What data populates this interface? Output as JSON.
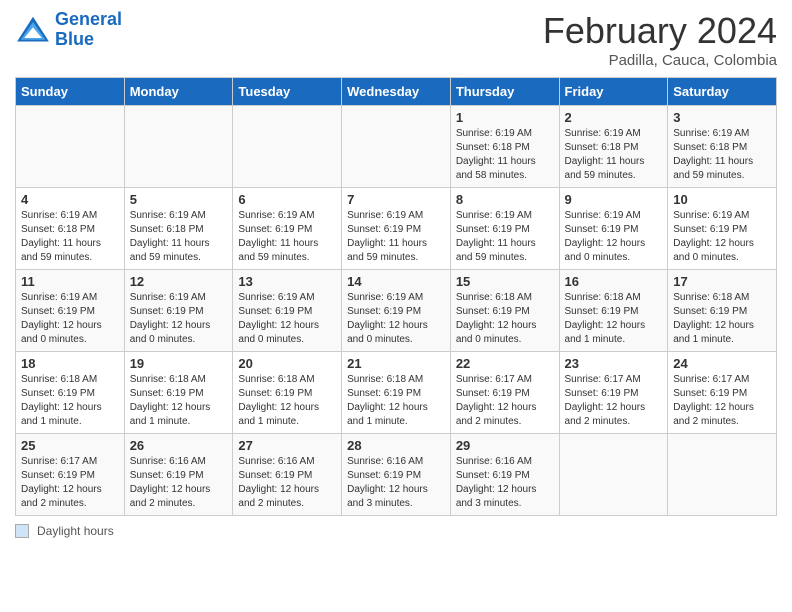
{
  "logo": {
    "line1": "General",
    "line2": "Blue"
  },
  "header": {
    "month": "February 2024",
    "location": "Padilla, Cauca, Colombia"
  },
  "weekdays": [
    "Sunday",
    "Monday",
    "Tuesday",
    "Wednesday",
    "Thursday",
    "Friday",
    "Saturday"
  ],
  "legend_label": "Daylight hours",
  "weeks": [
    [
      {
        "day": "",
        "sunrise": "",
        "sunset": "",
        "daylight": ""
      },
      {
        "day": "",
        "sunrise": "",
        "sunset": "",
        "daylight": ""
      },
      {
        "day": "",
        "sunrise": "",
        "sunset": "",
        "daylight": ""
      },
      {
        "day": "",
        "sunrise": "",
        "sunset": "",
        "daylight": ""
      },
      {
        "day": "1",
        "sunrise": "Sunrise: 6:19 AM",
        "sunset": "Sunset: 6:18 PM",
        "daylight": "Daylight: 11 hours and 58 minutes."
      },
      {
        "day": "2",
        "sunrise": "Sunrise: 6:19 AM",
        "sunset": "Sunset: 6:18 PM",
        "daylight": "Daylight: 11 hours and 59 minutes."
      },
      {
        "day": "3",
        "sunrise": "Sunrise: 6:19 AM",
        "sunset": "Sunset: 6:18 PM",
        "daylight": "Daylight: 11 hours and 59 minutes."
      }
    ],
    [
      {
        "day": "4",
        "sunrise": "Sunrise: 6:19 AM",
        "sunset": "Sunset: 6:18 PM",
        "daylight": "Daylight: 11 hours and 59 minutes."
      },
      {
        "day": "5",
        "sunrise": "Sunrise: 6:19 AM",
        "sunset": "Sunset: 6:18 PM",
        "daylight": "Daylight: 11 hours and 59 minutes."
      },
      {
        "day": "6",
        "sunrise": "Sunrise: 6:19 AM",
        "sunset": "Sunset: 6:19 PM",
        "daylight": "Daylight: 11 hours and 59 minutes."
      },
      {
        "day": "7",
        "sunrise": "Sunrise: 6:19 AM",
        "sunset": "Sunset: 6:19 PM",
        "daylight": "Daylight: 11 hours and 59 minutes."
      },
      {
        "day": "8",
        "sunrise": "Sunrise: 6:19 AM",
        "sunset": "Sunset: 6:19 PM",
        "daylight": "Daylight: 11 hours and 59 minutes."
      },
      {
        "day": "9",
        "sunrise": "Sunrise: 6:19 AM",
        "sunset": "Sunset: 6:19 PM",
        "daylight": "Daylight: 12 hours and 0 minutes."
      },
      {
        "day": "10",
        "sunrise": "Sunrise: 6:19 AM",
        "sunset": "Sunset: 6:19 PM",
        "daylight": "Daylight: 12 hours and 0 minutes."
      }
    ],
    [
      {
        "day": "11",
        "sunrise": "Sunrise: 6:19 AM",
        "sunset": "Sunset: 6:19 PM",
        "daylight": "Daylight: 12 hours and 0 minutes."
      },
      {
        "day": "12",
        "sunrise": "Sunrise: 6:19 AM",
        "sunset": "Sunset: 6:19 PM",
        "daylight": "Daylight: 12 hours and 0 minutes."
      },
      {
        "day": "13",
        "sunrise": "Sunrise: 6:19 AM",
        "sunset": "Sunset: 6:19 PM",
        "daylight": "Daylight: 12 hours and 0 minutes."
      },
      {
        "day": "14",
        "sunrise": "Sunrise: 6:19 AM",
        "sunset": "Sunset: 6:19 PM",
        "daylight": "Daylight: 12 hours and 0 minutes."
      },
      {
        "day": "15",
        "sunrise": "Sunrise: 6:18 AM",
        "sunset": "Sunset: 6:19 PM",
        "daylight": "Daylight: 12 hours and 0 minutes."
      },
      {
        "day": "16",
        "sunrise": "Sunrise: 6:18 AM",
        "sunset": "Sunset: 6:19 PM",
        "daylight": "Daylight: 12 hours and 1 minute."
      },
      {
        "day": "17",
        "sunrise": "Sunrise: 6:18 AM",
        "sunset": "Sunset: 6:19 PM",
        "daylight": "Daylight: 12 hours and 1 minute."
      }
    ],
    [
      {
        "day": "18",
        "sunrise": "Sunrise: 6:18 AM",
        "sunset": "Sunset: 6:19 PM",
        "daylight": "Daylight: 12 hours and 1 minute."
      },
      {
        "day": "19",
        "sunrise": "Sunrise: 6:18 AM",
        "sunset": "Sunset: 6:19 PM",
        "daylight": "Daylight: 12 hours and 1 minute."
      },
      {
        "day": "20",
        "sunrise": "Sunrise: 6:18 AM",
        "sunset": "Sunset: 6:19 PM",
        "daylight": "Daylight: 12 hours and 1 minute."
      },
      {
        "day": "21",
        "sunrise": "Sunrise: 6:18 AM",
        "sunset": "Sunset: 6:19 PM",
        "daylight": "Daylight: 12 hours and 1 minute."
      },
      {
        "day": "22",
        "sunrise": "Sunrise: 6:17 AM",
        "sunset": "Sunset: 6:19 PM",
        "daylight": "Daylight: 12 hours and 2 minutes."
      },
      {
        "day": "23",
        "sunrise": "Sunrise: 6:17 AM",
        "sunset": "Sunset: 6:19 PM",
        "daylight": "Daylight: 12 hours and 2 minutes."
      },
      {
        "day": "24",
        "sunrise": "Sunrise: 6:17 AM",
        "sunset": "Sunset: 6:19 PM",
        "daylight": "Daylight: 12 hours and 2 minutes."
      }
    ],
    [
      {
        "day": "25",
        "sunrise": "Sunrise: 6:17 AM",
        "sunset": "Sunset: 6:19 PM",
        "daylight": "Daylight: 12 hours and 2 minutes."
      },
      {
        "day": "26",
        "sunrise": "Sunrise: 6:16 AM",
        "sunset": "Sunset: 6:19 PM",
        "daylight": "Daylight: 12 hours and 2 minutes."
      },
      {
        "day": "27",
        "sunrise": "Sunrise: 6:16 AM",
        "sunset": "Sunset: 6:19 PM",
        "daylight": "Daylight: 12 hours and 2 minutes."
      },
      {
        "day": "28",
        "sunrise": "Sunrise: 6:16 AM",
        "sunset": "Sunset: 6:19 PM",
        "daylight": "Daylight: 12 hours and 3 minutes."
      },
      {
        "day": "29",
        "sunrise": "Sunrise: 6:16 AM",
        "sunset": "Sunset: 6:19 PM",
        "daylight": "Daylight: 12 hours and 3 minutes."
      },
      {
        "day": "",
        "sunrise": "",
        "sunset": "",
        "daylight": ""
      },
      {
        "day": "",
        "sunrise": "",
        "sunset": "",
        "daylight": ""
      }
    ]
  ]
}
